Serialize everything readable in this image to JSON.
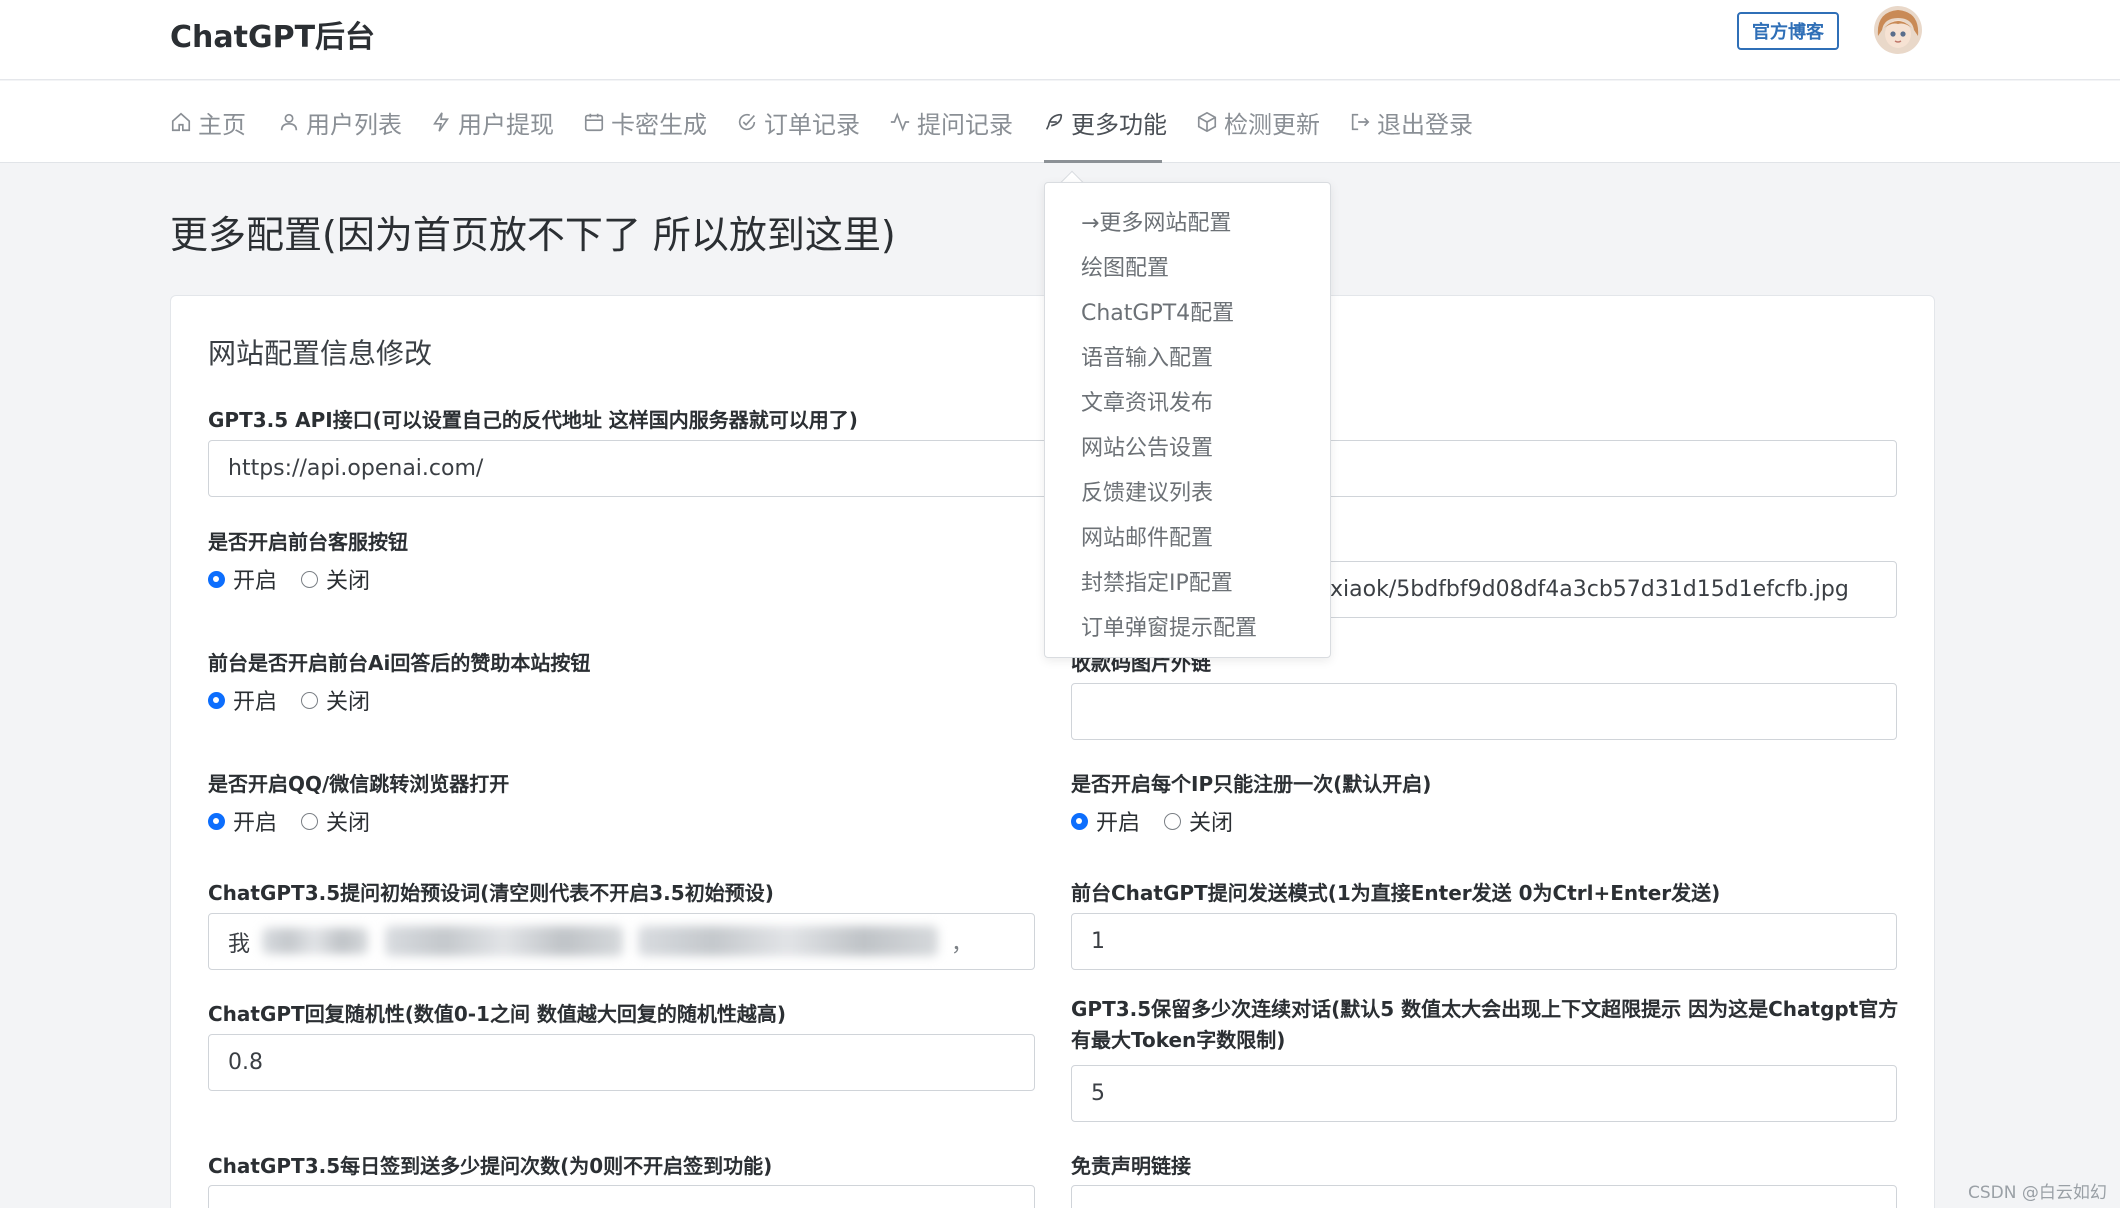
{
  "header": {
    "brand": "ChatGPT后台",
    "blog_button": "官方博客"
  },
  "nav": {
    "items": [
      {
        "label": "主页",
        "icon": "home-icon"
      },
      {
        "label": "用户列表",
        "icon": "user-icon"
      },
      {
        "label": "用户提现",
        "icon": "lightning-icon"
      },
      {
        "label": "卡密生成",
        "icon": "calendar-icon"
      },
      {
        "label": "订单记录",
        "icon": "check-circle-icon"
      },
      {
        "label": "提问记录",
        "icon": "activity-icon"
      },
      {
        "label": "更多功能",
        "icon": "feather-icon"
      },
      {
        "label": "检测更新",
        "icon": "box-icon"
      },
      {
        "label": "退出登录",
        "icon": "logout-icon"
      }
    ],
    "active_index": 6
  },
  "dropdown": {
    "items": [
      "→更多网站配置",
      "绘图配置",
      "ChatGPT4配置",
      "语音输入配置",
      "文章资讯发布",
      "网站公告设置",
      "反馈建议列表",
      "网站邮件配置",
      "封禁指定IP配置",
      "订单弹窗提示配置"
    ]
  },
  "page": {
    "title": "更多配置(因为首页放不下了 所以放到这里)",
    "card_title": "网站配置信息修改"
  },
  "form": {
    "api_label": "GPT3.5 API接口(可以设置自己的反代地址 这样国内服务器就可以用了)",
    "api_value": "https://api.openai.com/",
    "service_btn_label": "是否开启前台客服按钮",
    "image_url_value": "xiaok/5bdfbf9d08df4a3cb57d31d15d1efcfb.jpg",
    "sponsor_label": "前台是否开启前台Ai回答后的赞助本站按钮",
    "qrcode_label": "收款码图片外链",
    "qrcode_value": "",
    "qq_label": "是否开启QQ/微信跳转浏览器打开",
    "ip_once_label": "是否开启每个IP只能注册一次(默认开启)",
    "preset_label": "ChatGPT3.5提问初始预设词(清空则代表不开启3.5初始预设)",
    "preset_value_visible": "我",
    "preset_value_tail": "，",
    "send_mode_label": "前台ChatGPT提问发送模式(1为直接Enter发送 0为Ctrl+Enter发送)",
    "send_mode_value": "1",
    "randomness_label": "ChatGPT回复随机性(数值0-1之间 数值越大回复的随机性越高)",
    "randomness_value": "0.8",
    "context_label": "GPT3.5保留多少次连续对话(默认5 数值太大会出现上下文超限提示 因为这是Chatgpt官方有最大Token字数限制)",
    "context_value": "5",
    "checkin_label": "ChatGPT3.5每日签到送多少提问次数(为0则不开启签到功能)",
    "disclaimer_label": "免责声明链接",
    "radio_on": "开启",
    "radio_off": "关闭"
  },
  "watermark": "CSDN @白云如幻",
  "colors": {
    "primary": "#0d6efd",
    "blog_button": "#2f6fb7"
  }
}
